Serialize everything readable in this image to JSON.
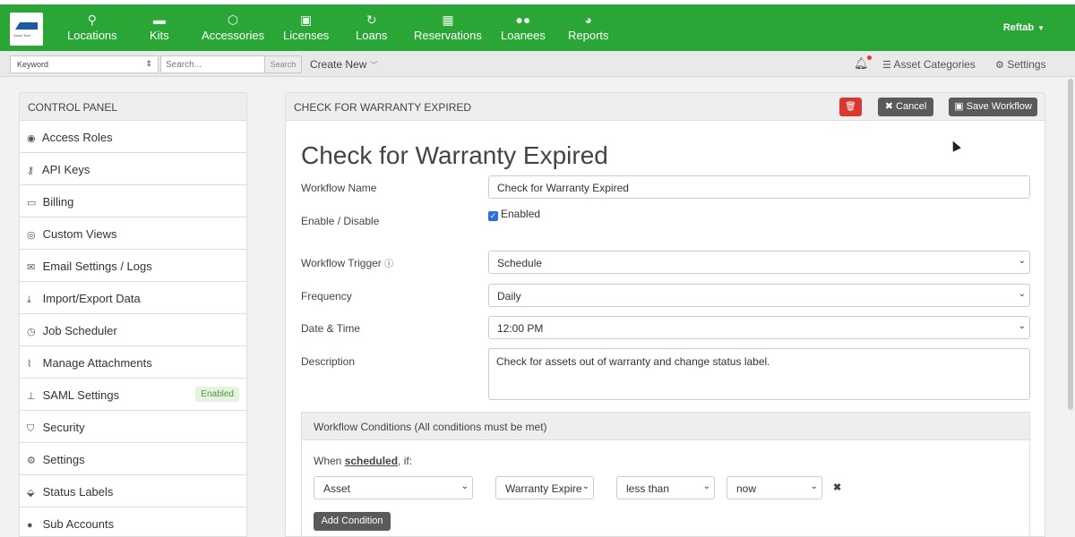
{
  "nav": {
    "logo_text": "Asset Tech",
    "items": [
      {
        "label": "Locations",
        "icon": "map-marker-icon"
      },
      {
        "label": "Kits",
        "icon": "briefcase-icon"
      },
      {
        "label": "Accessories",
        "icon": "cubes-icon"
      },
      {
        "label": "Licenses",
        "icon": "save-disk-icon"
      },
      {
        "label": "Loans",
        "icon": "refresh-icon"
      },
      {
        "label": "Reservations",
        "icon": "calendar-icon"
      },
      {
        "label": "Loanees",
        "icon": "users-icon"
      },
      {
        "label": "Reports",
        "icon": "pie-chart-icon"
      }
    ],
    "user": "Reftab"
  },
  "subbar": {
    "keyword_select": "Keyword",
    "search_placeholder": "Search...",
    "search_button": "Search",
    "create_new": "Create New",
    "asset_categories": "Asset Categories",
    "settings": "Settings"
  },
  "control_panel": {
    "title": "CONTROL PANEL",
    "items": [
      {
        "label": "Access Roles",
        "icon": "user-circle-icon"
      },
      {
        "label": "API Keys",
        "icon": "key-icon"
      },
      {
        "label": "Billing",
        "icon": "credit-card-icon"
      },
      {
        "label": "Custom Views",
        "icon": "eye-icon"
      },
      {
        "label": "Email Settings / Logs",
        "icon": "envelope-icon"
      },
      {
        "label": "Import/Export Data",
        "icon": "download-icon"
      },
      {
        "label": "Job Scheduler",
        "icon": "clock-icon"
      },
      {
        "label": "Manage Attachments",
        "icon": "paperclip-icon"
      },
      {
        "label": "SAML Settings",
        "icon": "sitemap-icon",
        "badge": "Enabled"
      },
      {
        "label": "Security",
        "icon": "shield-icon"
      },
      {
        "label": "Settings",
        "icon": "gears-icon"
      },
      {
        "label": "Status Labels",
        "icon": "tags-icon"
      },
      {
        "label": "Sub Accounts",
        "icon": "users-icon"
      }
    ]
  },
  "workflow": {
    "header": "CHECK FOR WARRANTY EXPIRED",
    "cancel": "Cancel",
    "save": "Save Workflow",
    "title": "Check for Warranty Expired",
    "labels": {
      "name": "Workflow Name",
      "enable": "Enable / Disable",
      "trigger": "Workflow Trigger",
      "frequency": "Frequency",
      "datetime": "Date & Time",
      "description": "Description"
    },
    "name_value": "Check for Warranty Expired",
    "enabled_label": "Enabled",
    "trigger_value": "Schedule",
    "frequency_value": "Daily",
    "time_value": "12:00 PM",
    "description_value": "Check for assets out of warranty and change status label.",
    "conditions": {
      "header": "Workflow Conditions (All conditions must be met)",
      "when_prefix": "When ",
      "when_keyword": "scheduled",
      "when_suffix": ", if:",
      "row": {
        "field": "Asset",
        "property": "Warranty Expire",
        "operator": "less than",
        "value": "now"
      },
      "add_button": "Add Condition"
    }
  }
}
